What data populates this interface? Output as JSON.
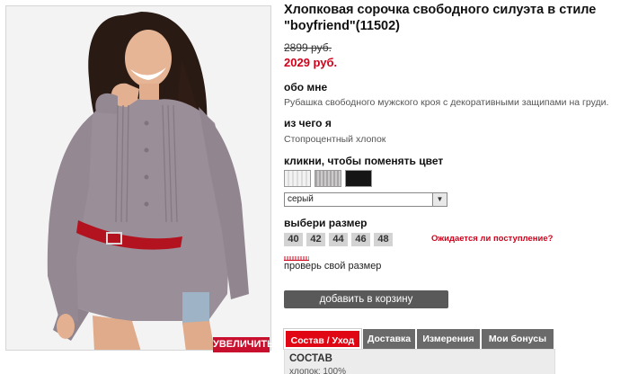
{
  "product": {
    "title": "Хлопковая сорочка свободного силуэта в стиле \"boyfriend\"(11502)",
    "old_price": "2899 руб.",
    "new_price": "2029 руб."
  },
  "about": {
    "heading": "обо мне",
    "text": "Рубашка свободного мужского кроя с декоративными защипами на груди."
  },
  "material": {
    "heading": "из чего я",
    "text": "Стопроцентный хлопок"
  },
  "color": {
    "heading": "кликни, чтобы поменять цвет",
    "selected": "серый"
  },
  "size": {
    "heading": "выбери размер",
    "options": [
      "40",
      "42",
      "44",
      "46",
      "48"
    ],
    "expect_link": "Ожидается ли поступление?",
    "check_label": "проверь свой размер"
  },
  "image": {
    "zoom_label": "УВЕЛИЧИТЬ"
  },
  "cart": {
    "add_label": "добавить в корзину"
  },
  "tabs": [
    {
      "label": "Состав / Уход",
      "active": true
    },
    {
      "label": "Доставка",
      "active": false
    },
    {
      "label": "Измерения",
      "active": false
    },
    {
      "label": "Мои бонусы",
      "active": false
    }
  ],
  "tab_panel": {
    "title": "СОСТАВ",
    "text": "хлопок: 100%"
  },
  "colors": {
    "accent": "#d0021b",
    "button": "#595959",
    "tab": "#6a6a6a",
    "tab_active": "#e10613"
  }
}
